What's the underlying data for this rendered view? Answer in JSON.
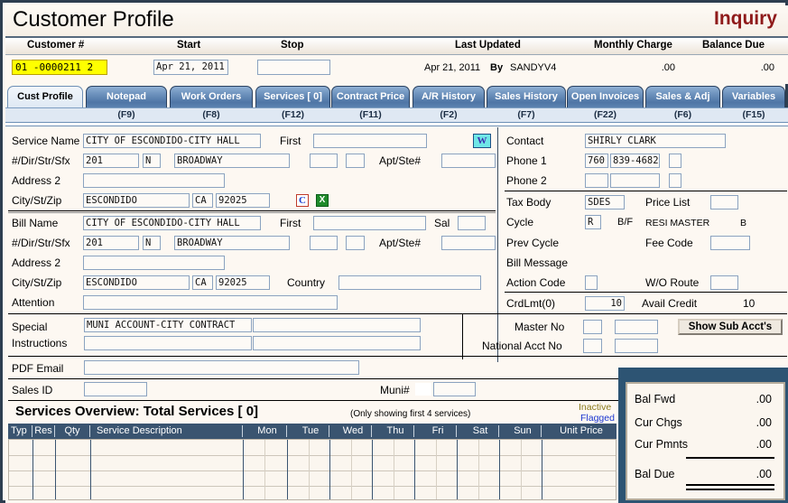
{
  "window": {
    "title": "Customer Profile",
    "mode": "Inquiry"
  },
  "header": {
    "labels": {
      "customer_no": "Customer #",
      "start": "Start",
      "stop": "Stop",
      "last_updated": "Last Updated",
      "monthly_charge": "Monthly Charge",
      "balance_due": "Balance Due"
    },
    "customer_no": "01 -0000211 2",
    "start": "Apr 21, 2011",
    "stop": "",
    "last_updated_date": "Apr 21, 2011",
    "by_label": "By",
    "last_updated_user": "SANDYV4",
    "monthly_charge": ".00",
    "balance_due": ".00"
  },
  "tabs": [
    {
      "label": "Cust Profile",
      "fkey": "",
      "active": true
    },
    {
      "label": "Notepad",
      "fkey": "(F9)",
      "active": false
    },
    {
      "label": "Work Orders",
      "fkey": "(F8)",
      "active": false
    },
    {
      "label": "Services [   0]",
      "fkey": "(F12)",
      "active": false
    },
    {
      "label": "Contract Price",
      "fkey": "(F11)",
      "active": false
    },
    {
      "label": "A/R History",
      "fkey": "(F2)",
      "active": false
    },
    {
      "label": "Sales History",
      "fkey": "(F7)",
      "active": false
    },
    {
      "label": "Open Invoices",
      "fkey": "(F22)",
      "active": false
    },
    {
      "label": "Sales & Adj",
      "fkey": "(F6)",
      "active": false
    },
    {
      "label": "Variables",
      "fkey": "(F15)",
      "active": false
    }
  ],
  "service_address": {
    "name_label": "Service Name",
    "name": "CITY OF ESCONDIDO-CITY HALL",
    "first_label": "First",
    "first": "",
    "dir_label": "#/Dir/Str/Sfx",
    "number": "201",
    "dir": "N",
    "street": "BROADWAY",
    "sfx1": "",
    "sfx2": "",
    "apt_label": "Apt/Ste#",
    "apt": "",
    "address2_label": "Address 2",
    "address2": "",
    "citystzip_label": "City/St/Zip",
    "city": "ESCONDIDO",
    "state": "CA",
    "zip": "92025"
  },
  "bill_address": {
    "name_label": "Bill Name",
    "name": "CITY OF ESCONDIDO-CITY HALL",
    "first_label": "First",
    "first": "",
    "sal_label": "Sal",
    "sal": "",
    "dir_label": "#/Dir/Str/Sfx",
    "number": "201",
    "dir": "N",
    "street": "BROADWAY",
    "sfx1": "",
    "sfx2": "",
    "apt_label": "Apt/Ste#",
    "apt": "",
    "address2_label": "Address 2",
    "address2": "",
    "citystzip_label": "City/St/Zip",
    "city": "ESCONDIDO",
    "state": "CA",
    "zip": "92025",
    "country_label": "Country",
    "country": "",
    "attention_label": "Attention",
    "attention": ""
  },
  "right_panel": {
    "contact_label": "Contact",
    "contact": "SHIRLY CLARK",
    "phone1_label": "Phone 1",
    "phone1_area": "760",
    "phone1_num": "839-4682",
    "phone1_ext": "",
    "phone2_label": "Phone 2",
    "phone2_area": "",
    "phone2_num": "",
    "phone2_ext": "",
    "tax_body_label": "Tax Body",
    "tax_body": "SDES",
    "price_list_label": "Price List",
    "price_list": "",
    "cycle_label": "Cycle",
    "cycle": "R",
    "bf_label": "B/F",
    "resi_master_label": "RESI MASTER",
    "resi_master_value": "B",
    "prev_cycle_label": "Prev Cycle",
    "prev_cycle": "",
    "fee_code_label": "Fee Code",
    "fee_code": "",
    "bill_message_label": "Bill Message",
    "action_code_label": "Action Code",
    "action_code": "",
    "wo_route_label": "W/O Route",
    "wo_route": "",
    "crdlmt_label": "CrdLmt(0)",
    "crdlmt": "10",
    "avail_credit_label": "Avail Credit",
    "avail_credit": "10"
  },
  "special": {
    "label_line1": "Special",
    "label_line2": "Instructions",
    "line1": "MUNI ACCOUNT-CITY CONTRACT",
    "line2": "",
    "line1b": "",
    "line2b": ""
  },
  "master": {
    "master_no_label": "Master No",
    "master_no_a": "",
    "master_no_b": "",
    "national_acct_label": "National Acct No",
    "national_a": "",
    "national_b": "",
    "show_sub_accts": "Show Sub Acct's"
  },
  "pdf_email": {
    "label": "PDF Email",
    "value": ""
  },
  "sales_id": {
    "label": "Sales ID",
    "value": "",
    "muni_label": "Muni#",
    "muni_flag": "",
    "muni_value": ""
  },
  "services_overview": {
    "title": "Services Overview: Total Services [   0]",
    "note": "(Only showing first 4 services)",
    "inactive_label": "Inactive",
    "flagged_label": "Flagged",
    "columns": [
      "Typ",
      "Res",
      "Qty",
      "Service Description",
      "Mon",
      "Tue",
      "Wed",
      "Thu",
      "Fri",
      "Sat",
      "Sun",
      "Unit Price"
    ],
    "rows": []
  },
  "balance": {
    "rows": [
      {
        "label": "Bal Fwd",
        "value": ".00"
      },
      {
        "label": "Cur Chgs",
        "value": ".00"
      },
      {
        "label": "Cur Pmnts",
        "value": ".00"
      }
    ],
    "due_label": "Bal Due",
    "due_value": ".00"
  },
  "icons": {
    "w": "W",
    "c": "C",
    "x": "X"
  },
  "colors": {
    "accent": "#8f1a1a",
    "tab": "#4f76a6",
    "table_header": "#3a5470",
    "highlight": "#ffff00",
    "inactive": "#8a7a1a",
    "flagged": "#1a36d0"
  }
}
